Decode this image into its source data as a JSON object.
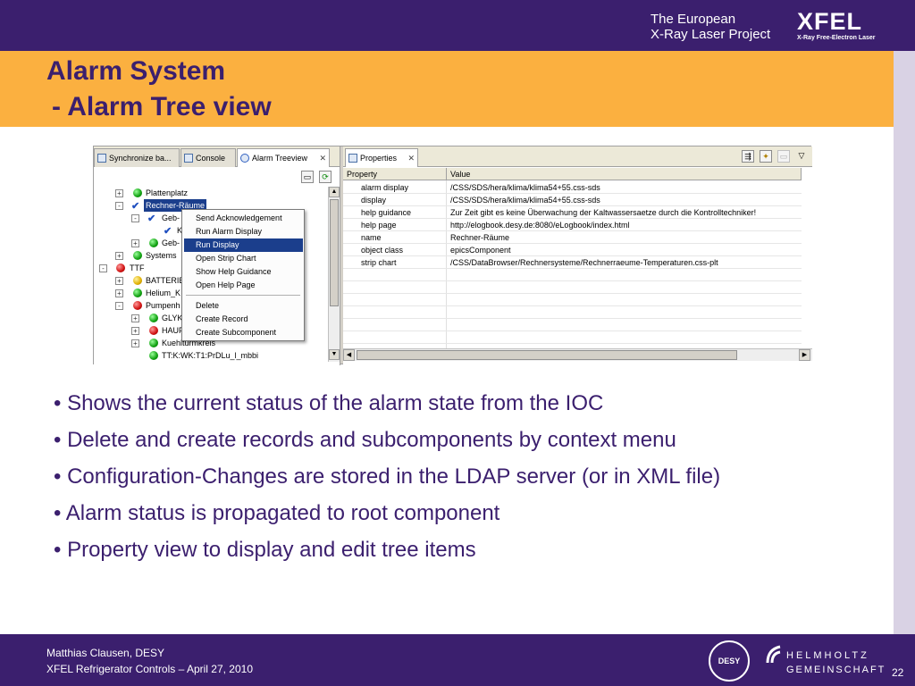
{
  "header": {
    "project_line1": "The European",
    "project_line2": "X-Ray Laser Project",
    "logo_text": "XFEL",
    "logo_subtext": "X-Ray Free-Electron Laser"
  },
  "title": {
    "line1": "Alarm System",
    "line2": "- Alarm Tree view"
  },
  "left_pane": {
    "tabs": [
      {
        "label": "Synchronize ba..."
      },
      {
        "label": "Console"
      },
      {
        "label": "Alarm Treeview"
      }
    ],
    "tree": [
      {
        "label": "Plattenplatz",
        "status": "green",
        "expander": "+"
      },
      {
        "label": "Rechner-Räume",
        "status": "check",
        "expander": "-",
        "selected": true
      },
      {
        "label": "Geb-",
        "status": "check",
        "expander": "-"
      },
      {
        "label": "K",
        "status": "check",
        "expander": ""
      },
      {
        "label": "Geb-",
        "status": "green",
        "expander": "+"
      },
      {
        "label": "Systems",
        "status": "green",
        "expander": "+"
      },
      {
        "label": "TTF",
        "status": "red",
        "expander": "-"
      },
      {
        "label": "BATTERIE",
        "status": "yellow",
        "expander": "+"
      },
      {
        "label": "Helium_K",
        "status": "green",
        "expander": "+"
      },
      {
        "label": "Pumpenh",
        "status": "red",
        "expander": "-"
      },
      {
        "label": "GLYK",
        "status": "green",
        "expander": "+"
      },
      {
        "label": "HAUP",
        "status": "red",
        "expander": "+"
      },
      {
        "label": "Kuehlturmkreis",
        "status": "green",
        "expander": "+"
      },
      {
        "label": "TT:K:WK:T1:PrDLu_l_mbbi",
        "status": "green",
        "expander": ""
      }
    ],
    "context_menu": [
      {
        "label": "Send Acknowledgement"
      },
      {
        "label": "Run Alarm Display"
      },
      {
        "label": "Run Display",
        "highlighted": true
      },
      {
        "label": "Open Strip Chart"
      },
      {
        "label": "Show Help Guidance"
      },
      {
        "label": "Open Help Page"
      },
      {
        "label": "Delete"
      },
      {
        "label": "Create Record"
      },
      {
        "label": "Create Subcomponent"
      }
    ]
  },
  "right_pane": {
    "tab": "Properties",
    "columns": [
      "Property",
      "Value"
    ],
    "rows": [
      {
        "key": "alarm display",
        "value": "/CSS/SDS/hera/klima/klima54+55.css-sds"
      },
      {
        "key": "display",
        "value": "/CSS/SDS/hera/klima/klima54+55.css-sds"
      },
      {
        "key": "help guidance",
        "value": "Zur Zeit gibt es keine Überwachung der Kaltwassersaetze durch die Kontrolltechniker!"
      },
      {
        "key": "help page",
        "value": "http://elogbook.desy.de:8080/eLogbook/index.html"
      },
      {
        "key": "name",
        "value": "Rechner-Räume"
      },
      {
        "key": "object class",
        "value": "epicsComponent"
      },
      {
        "key": "strip chart",
        "value": "/CSS/DataBrowser/Rechnersysteme/Rechnerraeume-Temperaturen.css-plt"
      }
    ]
  },
  "bullets": [
    "• Shows the current status of the alarm state from the IOC",
    "• Delete and create records and subcomponents by context menu",
    "• Configuration-Changes are stored in the LDAP server (or in XML file)",
    "• Alarm status is propagated to root component",
    "• Property view to display and edit tree items"
  ],
  "footer": {
    "author": "Matthias Clausen, DESY",
    "event": "XFEL Refrigerator Controls – April 27, 2010",
    "desy_logo": "DESY",
    "helmholtz_line1": "HELMHOLTZ",
    "helmholtz_line2": "GEMEINSCHAFT",
    "page_number": "22"
  },
  "colors": {
    "brand_purple": "#3b1f6e",
    "accent_orange": "#fbb040",
    "selection_blue": "#1b3e8c"
  }
}
